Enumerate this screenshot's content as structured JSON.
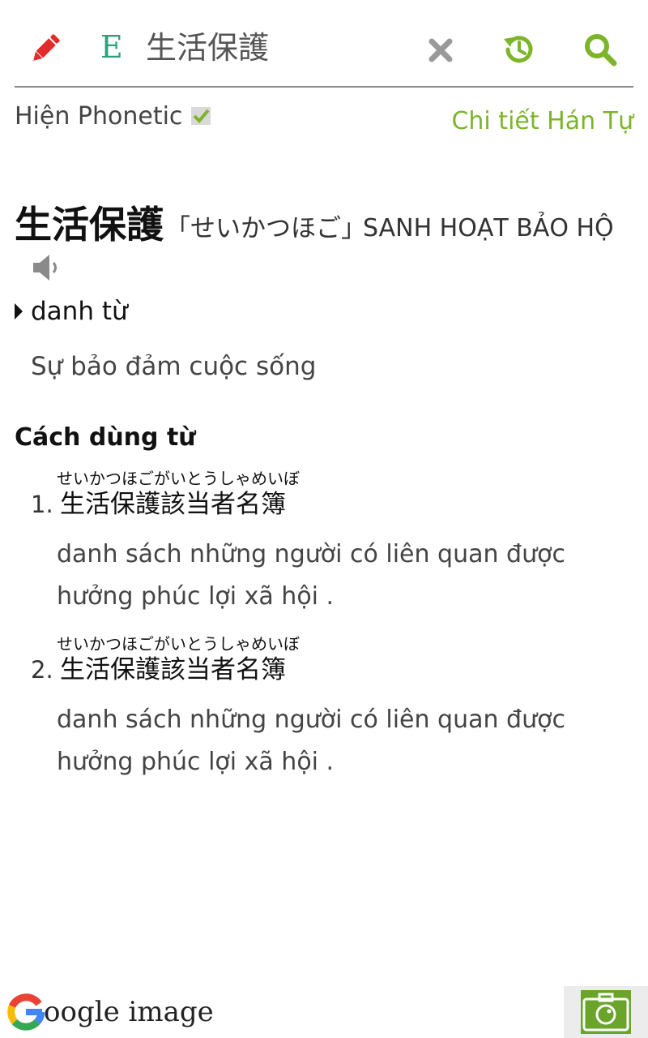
{
  "toolbar": {
    "edit_icon": "pencil-icon",
    "language_letter": "E",
    "search_value": "生活保護",
    "clear_icon": "close-icon",
    "history_icon": "history-icon",
    "search_icon": "search-icon"
  },
  "options": {
    "phonetic_label": "Hiện Phonetic",
    "phonetic_checked": true,
    "kanji_detail_link": "Chi tiết Hán Tự"
  },
  "entry": {
    "word": "生活保護",
    "reading": "「せいかつほご」",
    "hanviet": "SANH HOẠT BẢO HỘ",
    "speaker_icon": "speaker-icon",
    "part_of_speech": "danh từ",
    "meaning": "Sự bảo đảm cuộc sống"
  },
  "usage": {
    "title": "Cách dùng từ",
    "examples": [
      {
        "number": "1.",
        "furigana": "せいかつほごがいとうしゃめいぼ",
        "japanese": "生活保護該当者名簿",
        "translation": "danh sách những người có liên quan được hưởng phúc lợi xã hội ."
      },
      {
        "number": "2.",
        "furigana": "せいかつほごがいとうしゃめいぼ",
        "japanese": "生活保護該当者名簿",
        "translation": "danh sách những người có liên quan được hưởng phúc lợi xã hội ."
      }
    ]
  },
  "footer": {
    "google_image_label": "oogle image",
    "camera_icon": "camera-icon"
  },
  "colors": {
    "accent_green": "#7cb52a",
    "letter_green": "#2aa17a",
    "pencil_red": "#e32b2b",
    "clear_gray": "#9a9a9a"
  }
}
